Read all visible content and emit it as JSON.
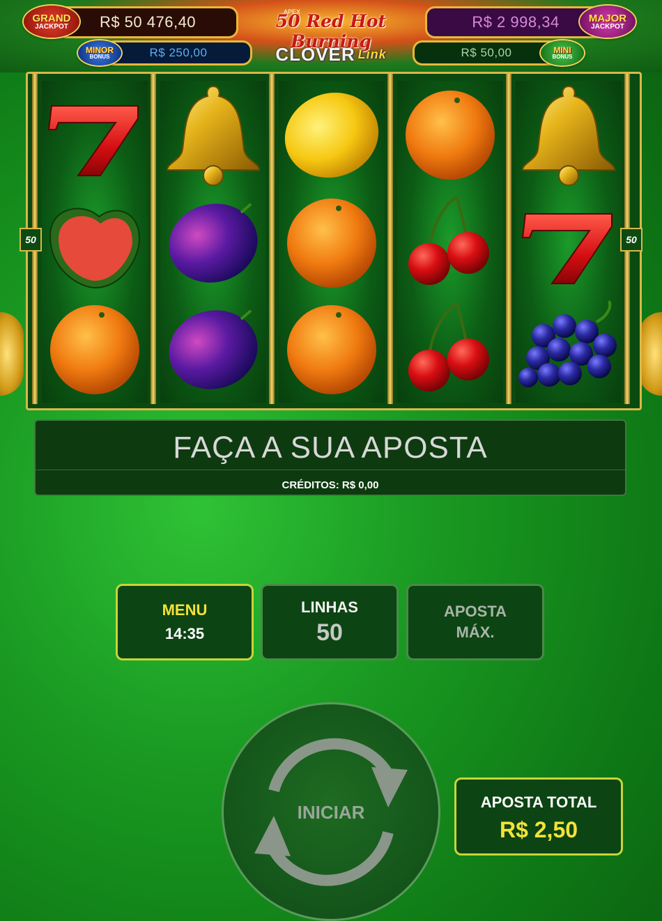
{
  "header": {
    "grand": {
      "word1": "GRAND",
      "word2": "JACKPOT",
      "value": "R$ 50 476,40"
    },
    "major": {
      "word1": "MAJOR",
      "word2": "JACKPOT",
      "value": "R$ 2 998,34"
    },
    "minor": {
      "word1": "MINOR",
      "word2": "BONUS",
      "value": "R$ 250,00"
    },
    "mini": {
      "word1": "MINI",
      "word2": "BONUS",
      "value": "R$ 50,00"
    },
    "title": {
      "apex": "APEX",
      "main": "50 Red Hot Burning",
      "sub": "CLOVER",
      "sub_link": "Link"
    }
  },
  "reels": {
    "lines_marker_left": "50",
    "lines_marker_right": "50",
    "columns": [
      [
        "seven-icon",
        "watermelon-icon",
        "orange-icon"
      ],
      [
        "bell-icon",
        "plum-icon",
        "plum-icon"
      ],
      [
        "lemon-icon",
        "orange-icon",
        "orange-icon"
      ],
      [
        "orange-icon",
        "cherry-icon",
        "cherry-icon"
      ],
      [
        "bell-icon",
        "seven-icon",
        "grapes-icon"
      ]
    ]
  },
  "message": {
    "main": "FAÇA A SUA APOSTA",
    "credits": "CRÉDITOS: R$ 0,00"
  },
  "controls": {
    "menu_label": "MENU",
    "menu_time": "14:35",
    "lines_label": "LINHAS",
    "lines_value": "50",
    "maxbet_line1": "APOSTA",
    "maxbet_line2": "MÁX.",
    "spin_label": "INICIAR",
    "total_label": "APOSTA TOTAL",
    "total_value": "R$ 2,50"
  },
  "colors": {
    "grand_value": "#f4ecd2",
    "major_value": "#d88ad8",
    "minor_value": "#5ab0f0",
    "mini_value": "#aad6aa",
    "menu_label": "#f4e23a",
    "total_value": "#f4e23a"
  }
}
